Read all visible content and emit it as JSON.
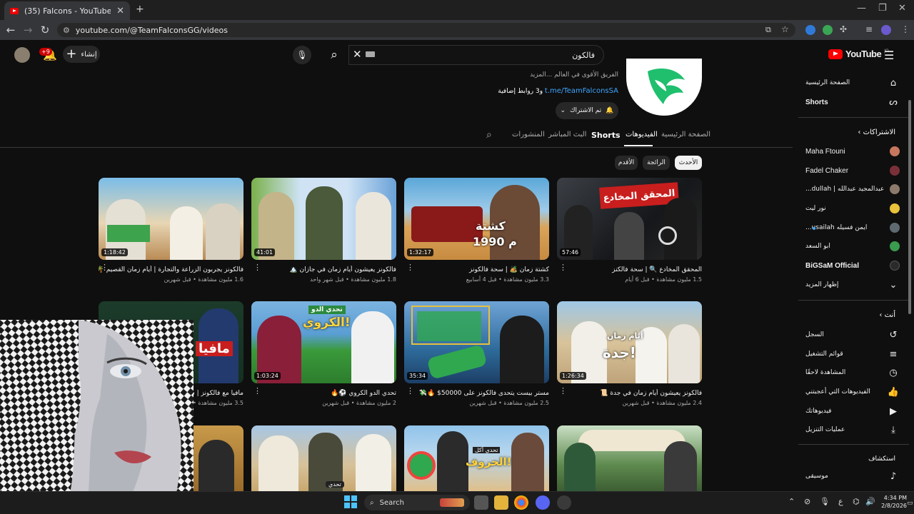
{
  "browser": {
    "tab_title": "(35) Falcons - YouTube",
    "url": "youtube.com/@TeamFalconsGG/videos"
  },
  "header": {
    "search_value": "فالكون",
    "create_label": "إنشاء",
    "notification_count": "+9",
    "logo": "YouTube",
    "logo_region": "JO"
  },
  "channel": {
    "description": "الفريق الأقوى في العالم ...المزيد",
    "link": "t.me/TeamFalconsSA",
    "link_suffix": "و3 روابط إضافية",
    "subscribed_label": "تم الاشتراك",
    "tabs": [
      "الصفحة الرئيسية",
      "الفيديوهات",
      "Shorts",
      "البث المباشر",
      "المنشورات"
    ],
    "active_tab": "الفيديوهات"
  },
  "chips": [
    "الأحدث",
    "الرائجة",
    "الأقدم"
  ],
  "videos": [
    {
      "title": "المحقق المخادع 🔍 | سحة فالكنز",
      "meta": "1.5 مليون مشاهدة • قبل 6 أيام",
      "duration": "57:46"
    },
    {
      "title": "كشتة زمان 🏕️ | سحة فالكونز",
      "meta": "3.3 مليون مشاهدة • قبل 4 أسابيع",
      "duration": "1:32:17"
    },
    {
      "title": "فالكونز يعيشون أيام زمان في جازان 🏔️",
      "meta": "1.8 مليون مشاهدة • قبل شهر واحد",
      "duration": "41:01"
    },
    {
      "title": "فالكونز يجربون الزراعة والتجارة | أيام زمان القصيم 🌴",
      "meta": "1.6 مليون مشاهدة • قبل شهرين",
      "duration": "1:18:42"
    },
    {
      "title": "فالكونز يعيشون أيام زمان في جدة 📜",
      "meta": "2.4 مليون مشاهدة • قبل شهرين",
      "duration": "1:26:34"
    },
    {
      "title": "مستر بيست يتحدى فالكونز على 50000$ 🔥💸",
      "meta": "2.5 مليون مشاهدة • قبل شهرين",
      "duration": "35:34"
    },
    {
      "title": "تحدي الدو الكروي ⚽🔥",
      "meta": "2 مليون مشاهدة • قبل شهرين",
      "duration": "1:03:24"
    },
    {
      "title": "مافيا مع فالكونز | سحة فالكونز",
      "meta": "3.5 مليون مشاهدة • قبل شهرين",
      "duration": ""
    }
  ],
  "thumb_text": {
    "t1_banner": "المحقق المخادع",
    "t2_banner": "كشتة",
    "t2_year": "1990 م",
    "t5_banner": "أيام زمان",
    "t5_city": "جدة!",
    "t7_banner": "تحدي الدو",
    "t7_word": "الكروي!",
    "t8_word": "مافيا",
    "t10_tag": "تحدي",
    "t11_banner": "تحدي أكل",
    "t11_word": "الحروف!"
  },
  "sidebar": {
    "home": "الصفحة الرئيسية",
    "shorts": "Shorts",
    "subscriptions_header": "الاشتراكات",
    "subscriptions": [
      {
        "name": "Maha Ftouni",
        "color": "#c7775e"
      },
      {
        "name": "Fadel Chaker",
        "color": "#7a3038"
      },
      {
        "name": "عبدالمجيد عبدالله | dullah...",
        "color": "#8d7a6a"
      },
      {
        "name": "نور ليت",
        "color": "#e7c23a"
      },
      {
        "name": "ايمن فسيله usailah...",
        "color": "#5f6a70"
      },
      {
        "name": "ابو السعد",
        "color": "#3a9a4e"
      },
      {
        "name": "BiGSaM Official",
        "color": "#2a2a2a"
      }
    ],
    "show_more": "إظهار المزيد",
    "you_header": "أنت",
    "you_items": [
      {
        "label": "السجل",
        "icon": "history-icon"
      },
      {
        "label": "قوائم التشغيل",
        "icon": "playlists-icon"
      },
      {
        "label": "المشاهدة لاحقًا",
        "icon": "watch-later-icon"
      },
      {
        "label": "الفيديوهات التي أعجبتني",
        "icon": "like-icon"
      },
      {
        "label": "فيديوهاتك",
        "icon": "your-videos-icon"
      },
      {
        "label": "عمليات التنزيل",
        "icon": "download-icon"
      }
    ],
    "explore_header": "استكشاف",
    "explore_items": [
      {
        "label": "موسيقى",
        "icon": "music-icon"
      }
    ]
  },
  "taskbar": {
    "search_label": "Search",
    "time": "4:34 PM",
    "date": "2/8/2026",
    "lang": "ع"
  }
}
